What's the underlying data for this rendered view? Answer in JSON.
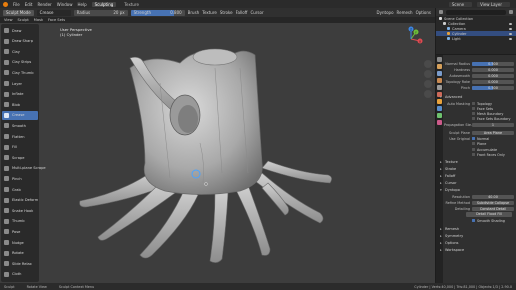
{
  "topbar": {
    "menus": [
      "File",
      "Edit",
      "Render",
      "Window",
      "Help"
    ],
    "tabs": [
      "Sculpting",
      "Texture"
    ],
    "active_tab": "Sculpting",
    "scene": "Scene",
    "view_layer": "View Layer"
  },
  "header": {
    "mode": "Sculpt Mode",
    "brush": "Crease",
    "radius_label": "Radius",
    "radius_value": "20 px",
    "strength_label": "Strength",
    "strength_value": "0.800",
    "strength_fraction": 0.8,
    "menus": [
      "Brush",
      "Texture",
      "Stroke",
      "Falloff",
      "Cursor"
    ],
    "right_items": [
      "Dyntopo",
      "Remesh",
      "Options"
    ]
  },
  "subheader": {
    "menus": [
      "View",
      "Sculpt",
      "Mask",
      "Face Sets"
    ]
  },
  "viewport": {
    "view_name": "User Perspective",
    "object_name": "(1) Cylinder",
    "gizmo_axes": [
      "X",
      "Y",
      "Z"
    ]
  },
  "toolbar": {
    "tools": [
      "Draw",
      "Draw Sharp",
      "Clay",
      "Clay Strips",
      "Clay Thumb",
      "Layer",
      "Inflate",
      "Blob",
      "Crease",
      "Smooth",
      "Flatten",
      "Fill",
      "Scrape",
      "Multi-plane Scrape",
      "Pinch",
      "Grab",
      "Elastic Deform",
      "Snake Hook",
      "Thumb",
      "Pose",
      "Nudge",
      "Rotate",
      "Slide Relax",
      "Cloth"
    ],
    "active": "Crease"
  },
  "outliner": {
    "title": "Scene Collection",
    "items": [
      {
        "label": "Collection",
        "color": "#cccccc",
        "selected": false
      },
      {
        "label": "Camera",
        "color": "#7fb2e5",
        "selected": false
      },
      {
        "label": "Cylinder",
        "color": "#e8a23c",
        "selected": true
      },
      {
        "label": "Light",
        "color": "#7fb2e5",
        "selected": false
      }
    ]
  },
  "properties": {
    "rows": [
      {
        "label": "Normal Radius",
        "value": "0.500",
        "fill": 0.5
      },
      {
        "label": "Hardness",
        "value": "0.000",
        "fill": 0.0
      },
      {
        "label": "Autosmooth",
        "value": "0.000",
        "fill": 0.0
      },
      {
        "label": "Topology Rake",
        "value": "0.000",
        "fill": 0.0
      },
      {
        "label": "Pinch",
        "value": "0.500",
        "fill": 0.5
      }
    ],
    "advanced": "Advanced",
    "auto_masking_label": "Auto Masking",
    "auto_masking_checks": [
      "Topology",
      "Face Sets",
      "Mesh Boundary",
      "Face Sets Boundary"
    ],
    "propagation_label": "Propagation Ste...",
    "propagation_value": "1",
    "sculpt_plane_label": "Sculpt Plane",
    "sculpt_plane_value": "Area Plane",
    "use_original_label": "Use Original",
    "use_original_checks": [
      "Normal",
      "Plane"
    ],
    "extra_checks": [
      "Accumulate",
      "Front Faces Only"
    ],
    "sections": [
      "Texture",
      "Stroke",
      "Falloff",
      "Cursor"
    ],
    "dyntopo_label": "Dyntopo",
    "resolution_label": "Resolution",
    "resolution_value": "40.00",
    "refine_label": "Refine Method",
    "refine_value": "Subdivide Collapse",
    "detailing_label": "Detailing",
    "detailing_value": "Constant Detail",
    "detail_flood_fill": "Detail Flood Fill",
    "smooth_shading": "Smooth Shading",
    "bottom_sections": [
      "Remesh",
      "Symmetry",
      "Options",
      "Workspace"
    ]
  },
  "statusbar": {
    "items": [
      "Sculpt",
      "Rotate View",
      "Sculpt Context Menu"
    ],
    "version": "Cylinder | Verts:40,000 | Tris:81,000 | Objects:1/3 | 2.90.0"
  }
}
